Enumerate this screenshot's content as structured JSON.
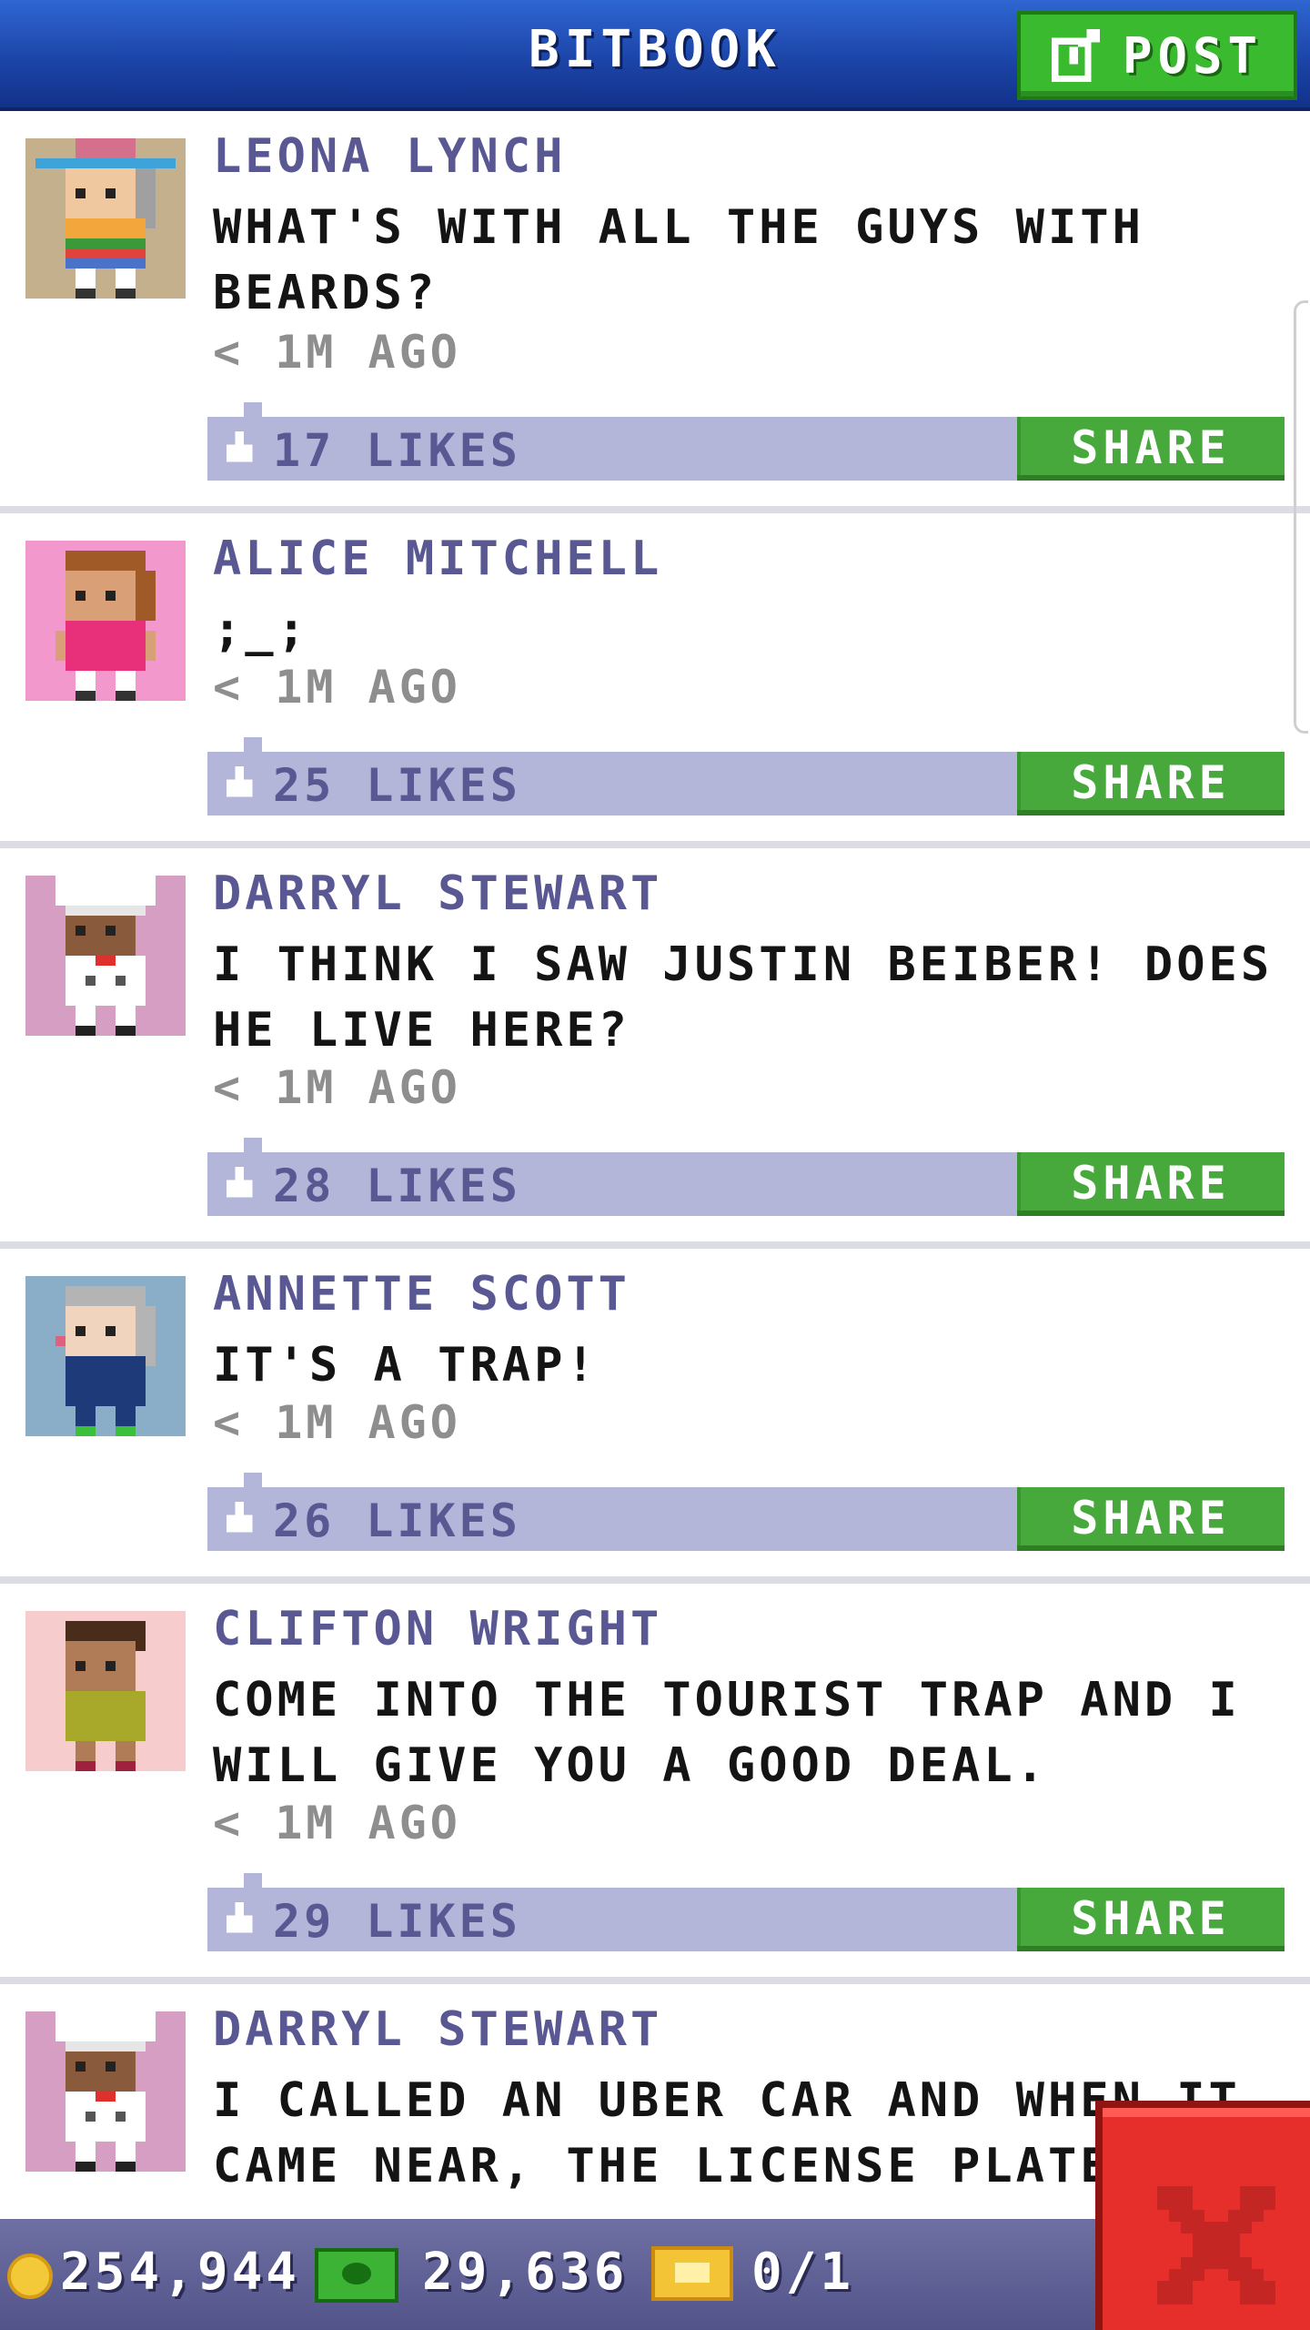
{
  "header": {
    "title": "BITBOOK",
    "post_label": "POST",
    "post_icon": "edit-icon"
  },
  "posts": [
    {
      "author": "LEONA LYNCH",
      "message": "WHAT'S WITH ALL THE GUYS WITH BEARDS?",
      "time": "< 1M AGO",
      "likes": "17 LIKES",
      "share": "SHARE",
      "avatar_bg": "#c4b08c"
    },
    {
      "author": "ALICE MITCHELL",
      "message": ";_;",
      "time": "< 1M AGO",
      "likes": "25 LIKES",
      "share": "SHARE",
      "avatar_bg": "#f398cc"
    },
    {
      "author": "DARRYL STEWART",
      "message": "I THINK I SAW JUSTIN BEIBER! DOES HE LIVE HERE?",
      "time": "< 1M AGO",
      "likes": "28 LIKES",
      "share": "SHARE",
      "avatar_bg": "#d79ec4"
    },
    {
      "author": "ANNETTE SCOTT",
      "message": "IT'S A TRAP!",
      "time": "< 1M AGO",
      "likes": "26 LIKES",
      "share": "SHARE",
      "avatar_bg": "#8aaec8"
    },
    {
      "author": "CLIFTON WRIGHT",
      "message": "COME INTO THE TOURIST TRAP AND I WILL GIVE YOU A GOOD DEAL.",
      "time": "< 1M AGO",
      "likes": "29 LIKES",
      "share": "SHARE",
      "avatar_bg": "#f6cccc"
    },
    {
      "author": "DARRYL STEWART",
      "message": "I CALLED AN UBER CAR AND WHEN IT CAME NEAR, THE LICENSE PLATE",
      "avatar_bg": "#d79ec4"
    }
  ],
  "status_bar": {
    "coins": "254,944",
    "cash": "29,636",
    "tickets": "0/1",
    "coin_icon": "coin-icon",
    "cash_icon": "bux-icon",
    "ticket_icon": "ticket-icon"
  },
  "close_icon": "close-icon",
  "colors": {
    "header_blue": "#1c45a8",
    "share_green": "#47a83b",
    "like_bar": "#b3b6d8",
    "author_purple": "#5a5893",
    "close_red": "#e62e2b"
  }
}
